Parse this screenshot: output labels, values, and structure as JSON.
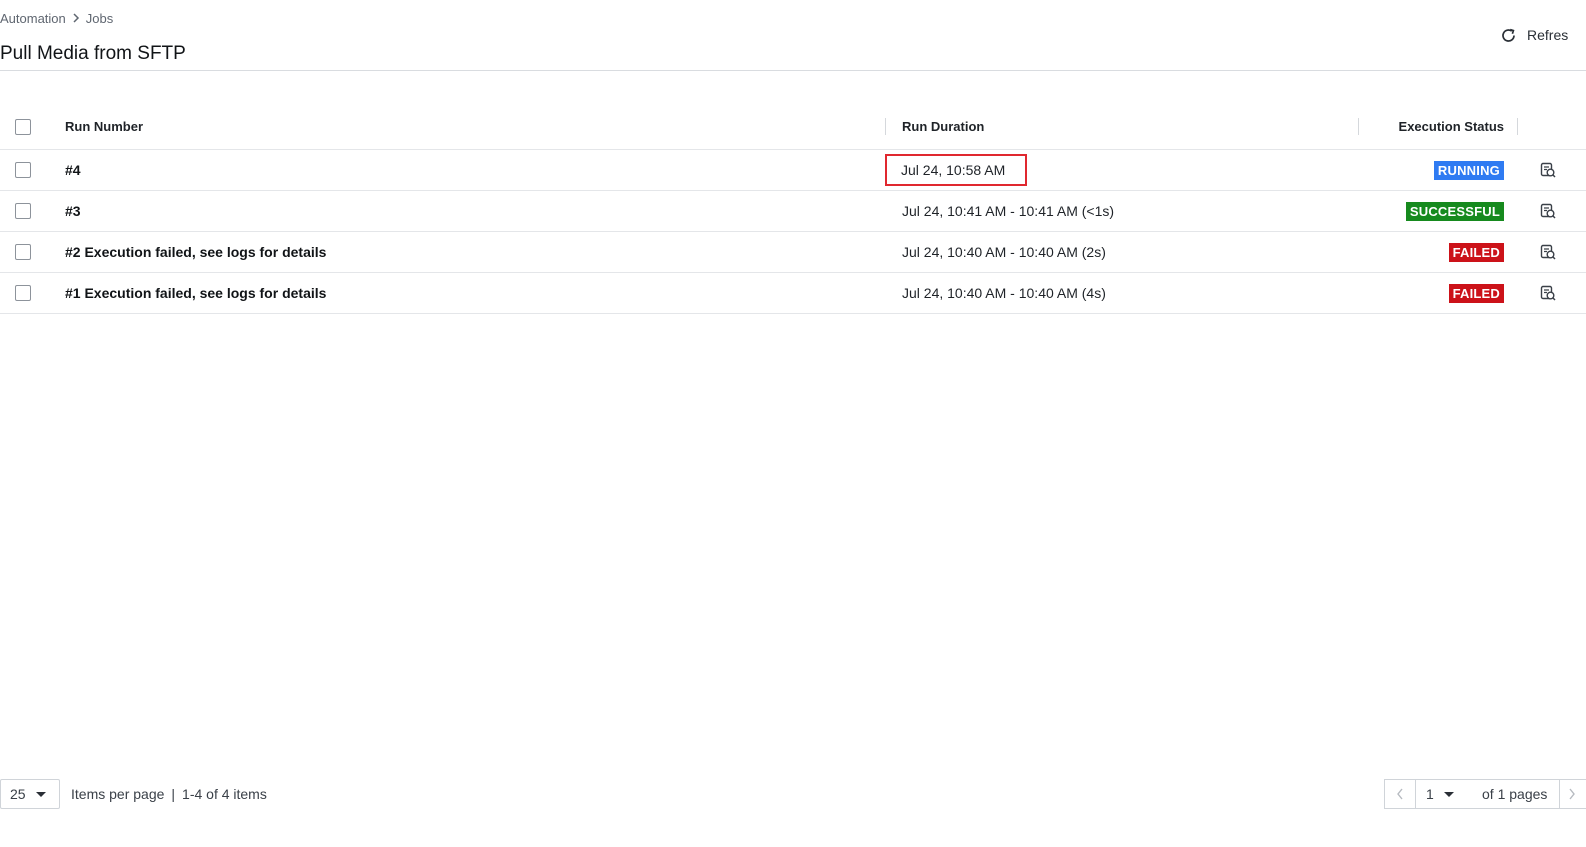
{
  "breadcrumb": {
    "items": [
      "Automation",
      "Jobs"
    ]
  },
  "header": {
    "title": "Pull Media from SFTP",
    "refresh_label": "Refres"
  },
  "table": {
    "columns": {
      "run_number": "Run Number",
      "run_duration": "Run Duration",
      "execution_status": "Execution Status"
    },
    "rows": [
      {
        "run": "#4",
        "duration": "Jul 24, 10:58 AM",
        "status": "RUNNING",
        "status_color": "#2f7bf2",
        "highlighted": true
      },
      {
        "run": "#3",
        "duration": "Jul 24, 10:41 AM - 10:41 AM (<1s)",
        "status": "SUCCESSFUL",
        "status_color": "#168a1e",
        "highlighted": false
      },
      {
        "run": "#2 Execution failed, see logs for details",
        "duration": "Jul 24, 10:40 AM - 10:40 AM (2s)",
        "status": "FAILED",
        "status_color": "#cc1219",
        "highlighted": false
      },
      {
        "run": "#1 Execution failed, see logs for details",
        "duration": "Jul 24, 10:40 AM - 10:40 AM (4s)",
        "status": "FAILED",
        "status_color": "#cc1219",
        "highlighted": false
      }
    ]
  },
  "footer": {
    "page_size": "25",
    "items_per_page_label": "Items per page",
    "separator": "|",
    "range_label": "1-4 of 4 items",
    "current_page": "1",
    "of_pages_label": "of 1 pages"
  },
  "colors": {
    "highlight_outline": "#e0282f"
  }
}
